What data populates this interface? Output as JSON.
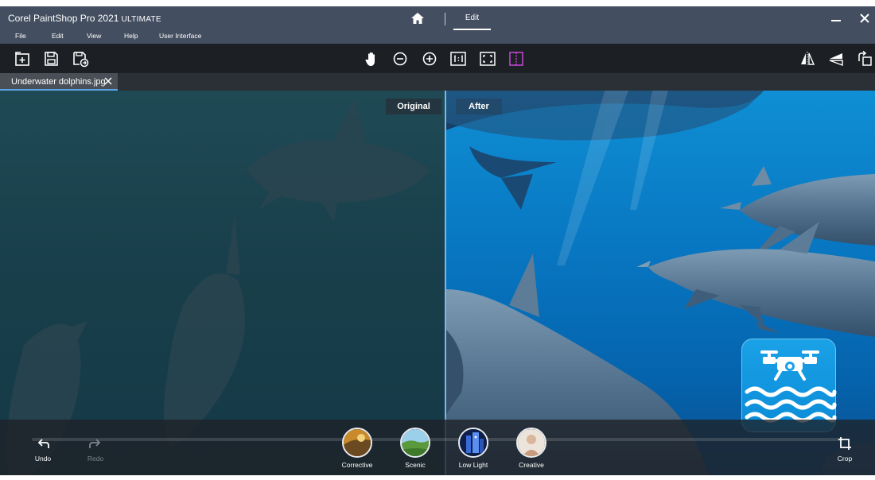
{
  "app": {
    "brand": "Corel PaintShop Pro 2021",
    "edition": "ULTIMATE",
    "mode_tab": "Edit"
  },
  "menu": {
    "items": [
      "File",
      "Edit",
      "View",
      "Help",
      "User Interface"
    ]
  },
  "toolbar": {
    "left_icons": [
      "new-image-icon",
      "save-icon",
      "save-as-icon"
    ],
    "center_icons": [
      "pan-hand-icon",
      "zoom-out-icon",
      "zoom-in-icon",
      "actual-size-icon",
      "fit-to-window-icon",
      "split-compare-icon"
    ],
    "right_icons": [
      "flip-horizontal-icon",
      "flip-vertical-icon",
      "rotate-icon"
    ],
    "active_icon_color": "#c44ad6"
  },
  "document": {
    "tab_label": "Underwater dolphins.jpg"
  },
  "compare": {
    "before_label": "Original",
    "after_label": "After"
  },
  "bottom": {
    "undo_label": "Undo",
    "redo_label": "Redo",
    "crop_label": "Crop",
    "presets": [
      {
        "label": "Corrective"
      },
      {
        "label": "Scenic"
      },
      {
        "label": "Low Light"
      },
      {
        "label": "Creative"
      }
    ]
  },
  "colors": {
    "title_bar": "#434e60",
    "accent": "#5aa5e8",
    "badge": "#1aa1e6"
  }
}
